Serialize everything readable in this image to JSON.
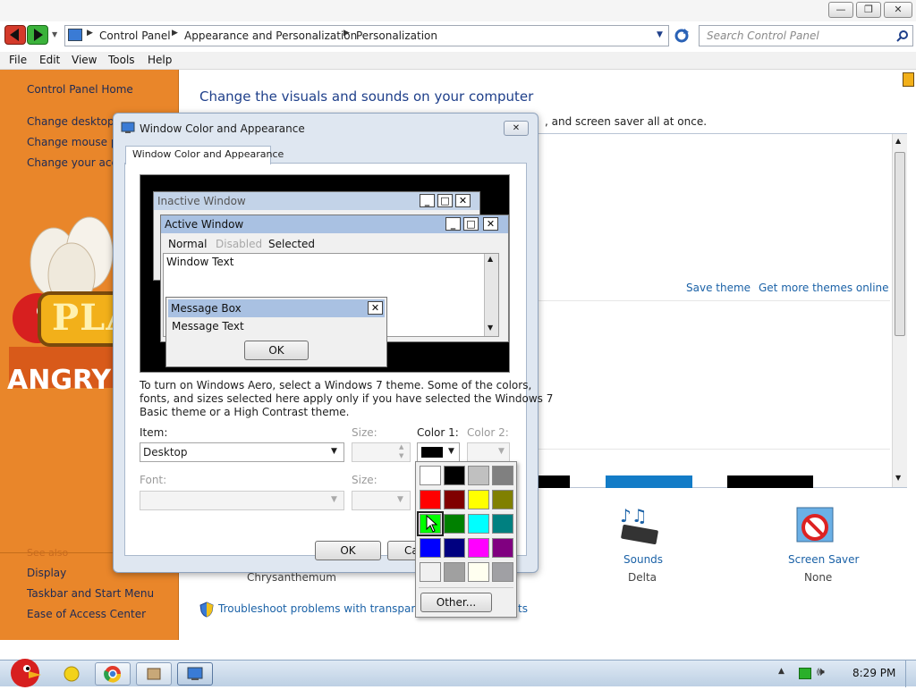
{
  "window": {
    "minimize_glyph": "—",
    "restore_glyph": "❐",
    "close_glyph": "✕"
  },
  "address": {
    "crumbs": [
      "Control Panel",
      "Appearance and Personalization",
      "Personalization"
    ],
    "search_placeholder": "Search Control Panel"
  },
  "menu": [
    "File",
    "Edit",
    "View",
    "Tools",
    "Help"
  ],
  "leftnav": {
    "home": "Control Panel Home",
    "links": [
      "Change desktop ic",
      "Change mouse po",
      "Change your acco"
    ],
    "see_also_label": "See also",
    "see_also": [
      "Display",
      "Taskbar and Start Menu",
      "Ease of Access Center"
    ],
    "ad_text_1": "PLA",
    "ad_text_2": "ANGRY B"
  },
  "content": {
    "heading": "Change the visuals and sounds on your computer",
    "subtext": ", and screen saver all at once.",
    "save_theme": "Save theme",
    "more_themes": "Get more themes online",
    "desktop_bg_label": "Chrysanthemum",
    "sounds_label": "Sounds",
    "sounds_value": "Delta",
    "screensaver_label": "Screen Saver",
    "screensaver_value": "None",
    "troubleshoot": "Troubleshoot problems with transparency",
    "troubleshoot_tail": "ts"
  },
  "dialog": {
    "title": "Window Color and Appearance",
    "tab": "Window Color and Appearance",
    "preview": {
      "inactive_title": "Inactive Window",
      "active_title": "Active Window",
      "menu_normal": "Normal",
      "menu_disabled": "Disabled",
      "menu_selected": "Selected",
      "window_text": "Window Text",
      "msgbox_title": "Message Box",
      "msgbox_text": "Message Text",
      "msgbox_ok": "OK"
    },
    "info_line1": "To turn on Windows Aero, select a Windows 7 theme.  Some of the colors,",
    "info_line2": "fonts, and sizes selected here apply only if you have selected the Windows 7",
    "info_line3": "Basic theme or a High Contrast theme.",
    "item_label": "Item:",
    "item_value": "Desktop",
    "size_label": "Size:",
    "color1_label": "Color 1:",
    "color2_label": "Color 2:",
    "font_label": "Font:",
    "font_size_label": "Size:",
    "ok": "OK",
    "cancel": "Ca",
    "color1_value": "#000000"
  },
  "palette": {
    "colors": [
      "#ffffff",
      "#000000",
      "#c0c0c0",
      "#808080",
      "#ff0000",
      "#800000",
      "#ffff00",
      "#808000",
      "#00ff00",
      "#008000",
      "#00ffff",
      "#008080",
      "#0000ff",
      "#000080",
      "#ff00ff",
      "#800080",
      "#f0f0f0",
      "#a0a0a0",
      "#fffff0",
      "#a0a0a4"
    ],
    "selected_index": 8,
    "other": "Other..."
  },
  "tray": {
    "time": "8:29 PM"
  },
  "accent": {
    "nav_orange": "#e9862a",
    "link_blue": "#1b62a7",
    "heading_blue": "#1e3f8a",
    "titlebar_inactive": "#c3d3e8"
  }
}
